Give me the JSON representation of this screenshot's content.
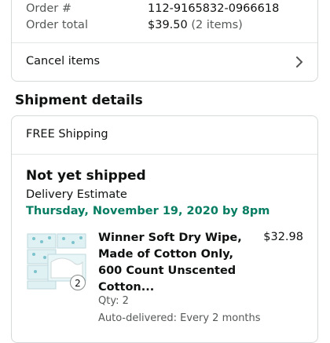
{
  "order": {
    "order_number_label": "Order #",
    "order_number": "112-9165832-0966618",
    "order_total_label": "Order total",
    "order_total": "$39.50",
    "item_count": "(2 items)"
  },
  "actions": {
    "cancel_items_label": "Cancel items"
  },
  "shipment": {
    "section_title": "Shipment details",
    "shipping_label": "FREE Shipping",
    "status": "Not yet shipped",
    "delivery_estimate_label": "Delivery Estimate",
    "delivery_date": "Thursday, November 19, 2020 by 8pm",
    "item": {
      "title": "Winner Soft Dry Wipe, Made of Cotton Only, 600 Count Unscented Cotton...",
      "price": "$32.98",
      "quantity_badge": "2",
      "qty_text": "Qty: 2",
      "auto_delivery": "Auto-delivered: Every 2 months"
    }
  },
  "colors": {
    "delivery_date": "#067d62",
    "border": "#d5d9d9"
  }
}
